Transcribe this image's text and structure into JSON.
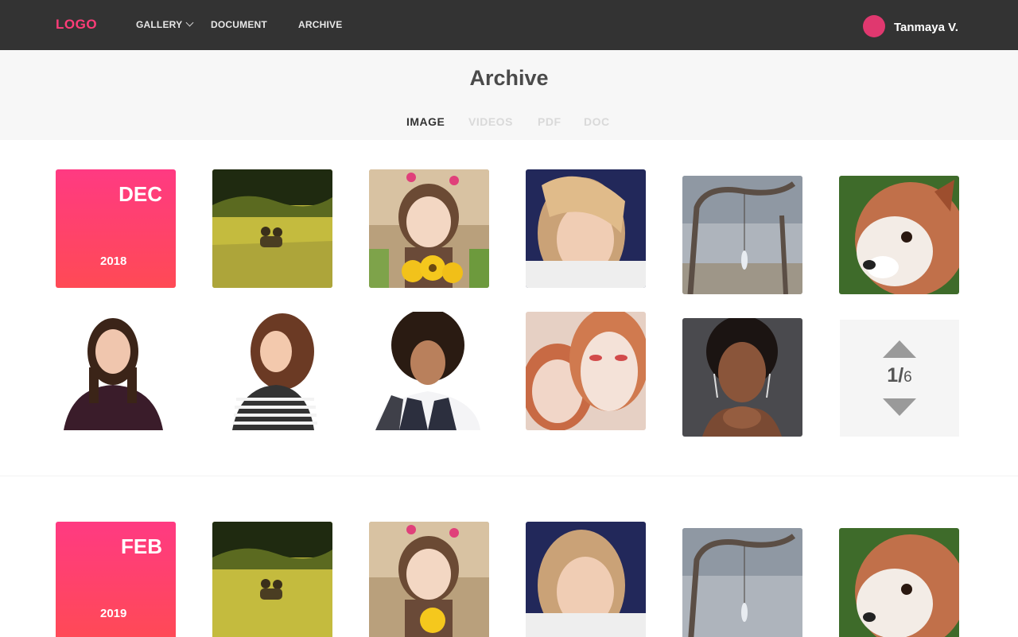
{
  "nav": {
    "logo": "LOGO",
    "items": [
      {
        "label": "GALLERY"
      },
      {
        "label": "DOCUMENT"
      },
      {
        "label": "ARCHIVE"
      }
    ],
    "user_name": "Tanmaya V."
  },
  "page": {
    "title": "Archive",
    "tabs": [
      {
        "label": "IMAGE",
        "active": true
      },
      {
        "label": "VIDEOS",
        "active": false
      },
      {
        "label": "PDF",
        "active": false
      },
      {
        "label": "DOC",
        "active": false
      }
    ]
  },
  "sections": [
    {
      "month": "DEC",
      "year": "2018"
    },
    {
      "month": "FEB",
      "year": "2019"
    }
  ],
  "pager": {
    "current": "1",
    "separator": "/",
    "total": "6"
  },
  "colors": {
    "accent": "#ff3c78",
    "topbar": "#333333",
    "avatar": "#e0386f"
  }
}
